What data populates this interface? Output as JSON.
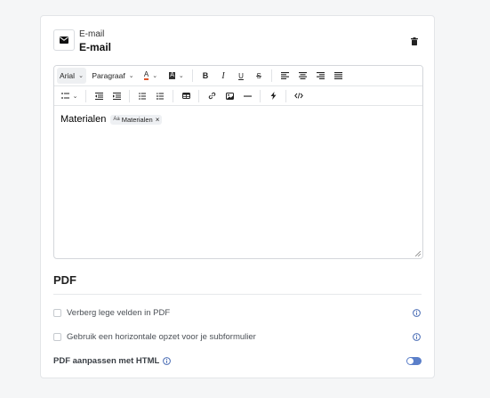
{
  "header": {
    "type_label": "E-mail",
    "title": "E-mail"
  },
  "toolbar": {
    "font_family": "Arial",
    "paragraph": "Paragraaf",
    "text_color_glyph": "A",
    "bg_color_glyph": "A",
    "bold_glyph": "B",
    "italic_glyph": "I",
    "underline_glyph": "U",
    "strike_glyph": "S",
    "icons": [
      "align-left-icon",
      "align-center-icon",
      "align-right-icon",
      "align-justify-icon",
      "list-style-icon",
      "outdent-icon",
      "indent-icon",
      "bullet-list-icon",
      "numbered-list-icon",
      "table-icon",
      "link-icon",
      "image-icon",
      "horizontal-rule-icon",
      "lightning-icon",
      "code-icon"
    ]
  },
  "editor": {
    "content_text": "Materialen",
    "chip_prefix": "Aa",
    "chip_label": "Materialen",
    "chip_close": "×"
  },
  "pdf": {
    "title": "PDF",
    "option1_label": "Verberg lege velden in PDF",
    "option2_label": "Gebruik een horizontale opzet voor je subformulier",
    "html_label": "PDF aanpassen met HTML",
    "option1_checked": false,
    "option2_checked": false,
    "html_toggle_on": true
  },
  "colors": {
    "accent": "#5b7fc9",
    "info": "#4a6db5",
    "text_color_a": "#e0552a",
    "bg_color_a": "#333333"
  }
}
